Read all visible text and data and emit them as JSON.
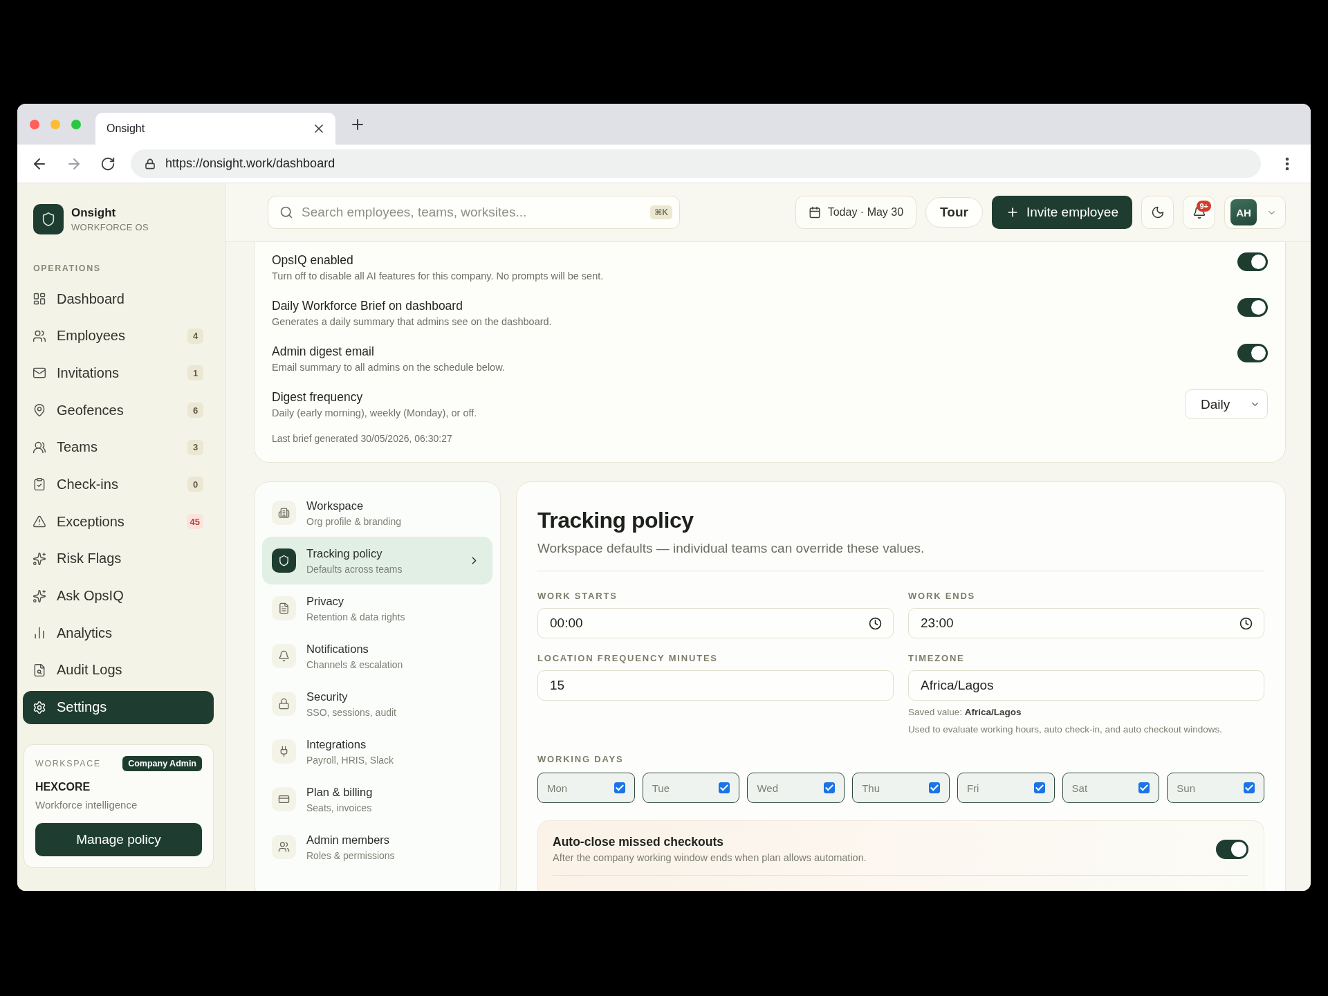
{
  "browser": {
    "tab_title": "Onsight",
    "url": "https://onsight.work/dashboard"
  },
  "sidebar": {
    "brand": {
      "name": "Onsight",
      "tagline": "WORKFORCE OS"
    },
    "section_label": "OPERATIONS",
    "items": [
      {
        "label": "Dashboard",
        "selected": false
      },
      {
        "label": "Employees",
        "count": "4",
        "alert": false,
        "selected": false
      },
      {
        "label": "Invitations",
        "count": "1",
        "alert": false,
        "selected": false
      },
      {
        "label": "Geofences",
        "count": "6",
        "alert": false,
        "selected": false
      },
      {
        "label": "Teams",
        "count": "3",
        "alert": false,
        "selected": false
      },
      {
        "label": "Check-ins",
        "count": "0",
        "alert": false,
        "selected": false
      },
      {
        "label": "Exceptions",
        "count": "45",
        "alert": true,
        "selected": false
      },
      {
        "label": "Risk Flags",
        "selected": false
      },
      {
        "label": "Ask OpsIQ",
        "selected": false
      },
      {
        "label": "Analytics",
        "selected": false
      },
      {
        "label": "Audit Logs",
        "selected": false
      },
      {
        "label": "Settings",
        "selected": true
      }
    ],
    "workspace": {
      "label": "WORKSPACE",
      "role": "Company Admin",
      "name": "HEXCORE",
      "description": "Workforce intelligence",
      "button": "Manage policy"
    }
  },
  "header": {
    "search": {
      "placeholder": "Search employees, teams, worksites...",
      "shortcut": "⌘K"
    },
    "date": "Today · May 30",
    "tour": "Tour",
    "invite": "Invite employee",
    "notifications": "9+",
    "avatar": "AH"
  },
  "ai_settings": {
    "rows": [
      {
        "kind": "toggle",
        "title": "OpsIQ enabled",
        "description": "Turn off to disable all AI features for this company. No prompts will be sent.",
        "on": true
      },
      {
        "kind": "toggle",
        "title": "Daily Workforce Brief on dashboard",
        "description": "Generates a daily summary that admins see on the dashboard.",
        "on": true
      },
      {
        "kind": "toggle",
        "title": "Admin digest email",
        "description": "Email summary to all admins on the schedule below.",
        "on": true
      },
      {
        "kind": "select",
        "title": "Digest frequency",
        "description": "Daily (early morning), weekly (Monday), or off.",
        "value": "Daily"
      }
    ],
    "footnote": "Last brief generated 30/05/2026, 06:30:27"
  },
  "settings_nav": {
    "items": [
      {
        "title": "Workspace",
        "subtitle": "Org profile & branding",
        "selected": false
      },
      {
        "title": "Tracking policy",
        "subtitle": "Defaults across teams",
        "selected": true
      },
      {
        "title": "Privacy",
        "subtitle": "Retention & data rights",
        "selected": false
      },
      {
        "title": "Notifications",
        "subtitle": "Channels & escalation",
        "selected": false
      },
      {
        "title": "Security",
        "subtitle": "SSO, sessions, audit",
        "selected": false
      },
      {
        "title": "Integrations",
        "subtitle": "Payroll, HRIS, Slack",
        "selected": false
      },
      {
        "title": "Plan & billing",
        "subtitle": "Seats, invoices",
        "selected": false
      },
      {
        "title": "Admin members",
        "subtitle": "Roles & permissions",
        "selected": false
      }
    ]
  },
  "tracking_policy": {
    "title": "Tracking policy",
    "subtitle": "Workspace defaults — individual teams can override these values.",
    "fields": [
      {
        "kind": "time",
        "label": "WORK STARTS",
        "value": "00:00"
      },
      {
        "kind": "time",
        "label": "WORK ENDS",
        "value": "23:00"
      },
      {
        "kind": "text",
        "label": "LOCATION FREQUENCY MINUTES",
        "value": "15"
      },
      {
        "kind": "text",
        "label": "TIMEZONE",
        "value": "Africa/Lagos",
        "notes": [
          "Saved value: **Africa/Lagos**",
          "Used to evaluate working hours, auto check-in, and auto checkout windows."
        ]
      }
    ],
    "working_days": {
      "label": "WORKING DAYS",
      "days": [
        {
          "label": "Mon",
          "checked": true
        },
        {
          "label": "Tue",
          "checked": true
        },
        {
          "label": "Wed",
          "checked": true
        },
        {
          "label": "Thu",
          "checked": true
        },
        {
          "label": "Fri",
          "checked": true
        },
        {
          "label": "Sat",
          "checked": true
        },
        {
          "label": "Sun",
          "checked": true
        }
      ]
    },
    "automation": {
      "title": "Auto-close missed checkouts",
      "description": "After the company working window ends when plan allows automation.",
      "on": true
    }
  }
}
